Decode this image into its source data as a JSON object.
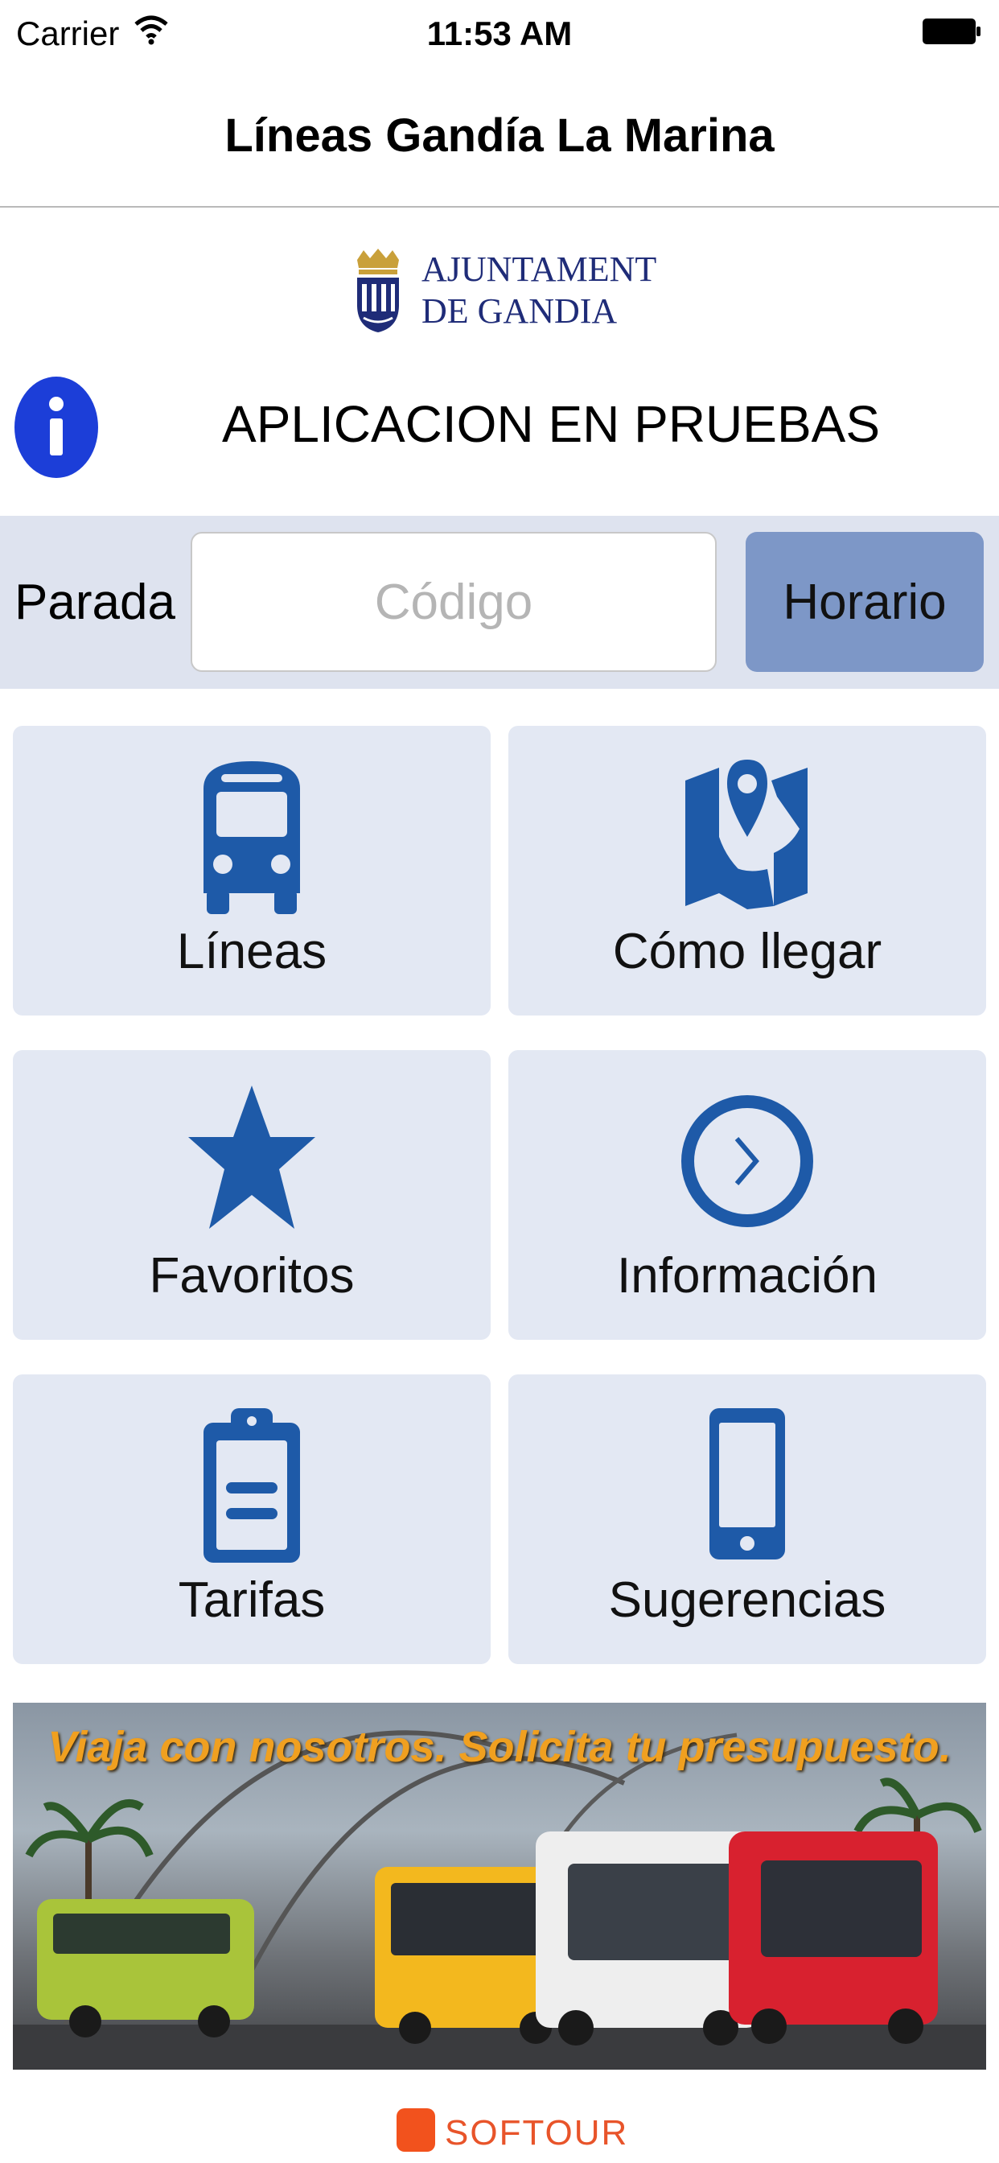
{
  "status_bar": {
    "carrier": "Carrier",
    "time": "11:53 AM"
  },
  "nav": {
    "title": "Líneas Gandía La Marina"
  },
  "logo": {
    "line1": "AJUNTAMENT",
    "line2": "DE GANDIA",
    "color": "#1f2c78"
  },
  "info": {
    "text": "APLICACION EN PRUEBAS",
    "icon": "info-icon",
    "icon_color": "#1c3ed8"
  },
  "stop": {
    "label": "Parada",
    "placeholder": "Código",
    "button": "Horario"
  },
  "tiles": [
    {
      "label": "Líneas",
      "icon": "bus-icon"
    },
    {
      "label": "Cómo llegar",
      "icon": "map-pin-icon"
    },
    {
      "label": "Favoritos",
      "icon": "star-icon"
    },
    {
      "label": "Información",
      "icon": "clock-arrow-icon"
    },
    {
      "label": "Tarifas",
      "icon": "clipboard-icon"
    },
    {
      "label": "Sugerencias",
      "icon": "phone-icon"
    }
  ],
  "banner": {
    "text": "Viaja con nosotros. Solicita tu presupuesto."
  },
  "footer": {
    "brand": "SOFTOUR"
  },
  "colors": {
    "tile_bg": "#e3e8f3",
    "panel_bg": "#dee3ef",
    "button_bg": "#7d97c7",
    "icon_blue": "#1e5aa8"
  }
}
